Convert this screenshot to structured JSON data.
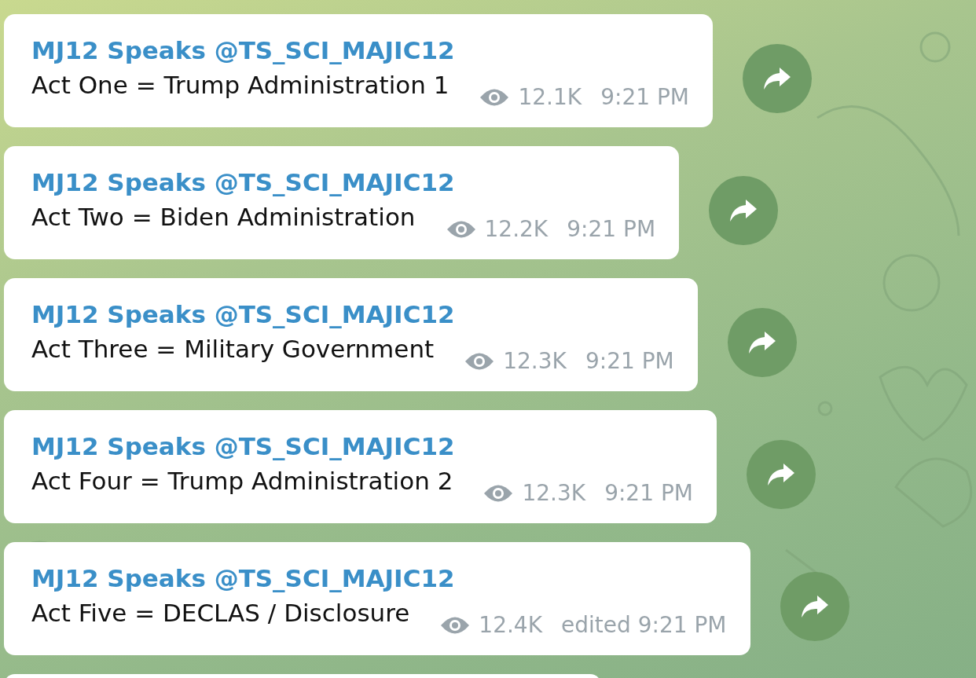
{
  "messages": [
    {
      "sender": "MJ12 Speaks @TS_SCI_MAJIC12",
      "text": "Act One = Trump Administration 1",
      "views": "12.1K",
      "time": "9:21 PM"
    },
    {
      "sender": "MJ12 Speaks @TS_SCI_MAJIC12",
      "text": "Act Two = Biden Administration",
      "views": "12.2K",
      "time": "9:21 PM"
    },
    {
      "sender": "MJ12 Speaks @TS_SCI_MAJIC12",
      "text": "Act Three = Military Government",
      "views": "12.3K",
      "time": "9:21 PM"
    },
    {
      "sender": "MJ12 Speaks @TS_SCI_MAJIC12",
      "text": "Act Four = Trump Administration 2",
      "views": "12.3K",
      "time": "9:21 PM"
    },
    {
      "sender": "MJ12 Speaks @TS_SCI_MAJIC12",
      "text": "Act Five = DECLAS / Disclosure",
      "views": "12.4K",
      "edit_mark": "edited",
      "time": "9:21 PM"
    }
  ]
}
